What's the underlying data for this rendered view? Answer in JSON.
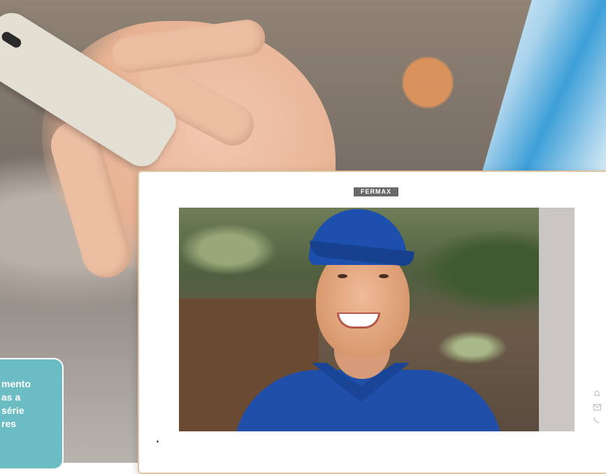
{
  "brand": {
    "name": "FERMAX"
  },
  "promo": {
    "lines": [
      "mento",
      "as a",
      "série",
      "res"
    ]
  },
  "monitor": {
    "side_icons": [
      "bell-icon",
      "envelope-icon",
      "phone-icon"
    ]
  },
  "colors": {
    "promo_background": "#6cbcc4",
    "monitor_frame": "#ffffff",
    "brand_plate": "#6a6a6a",
    "uniform_blue": "#1f4fa8"
  }
}
